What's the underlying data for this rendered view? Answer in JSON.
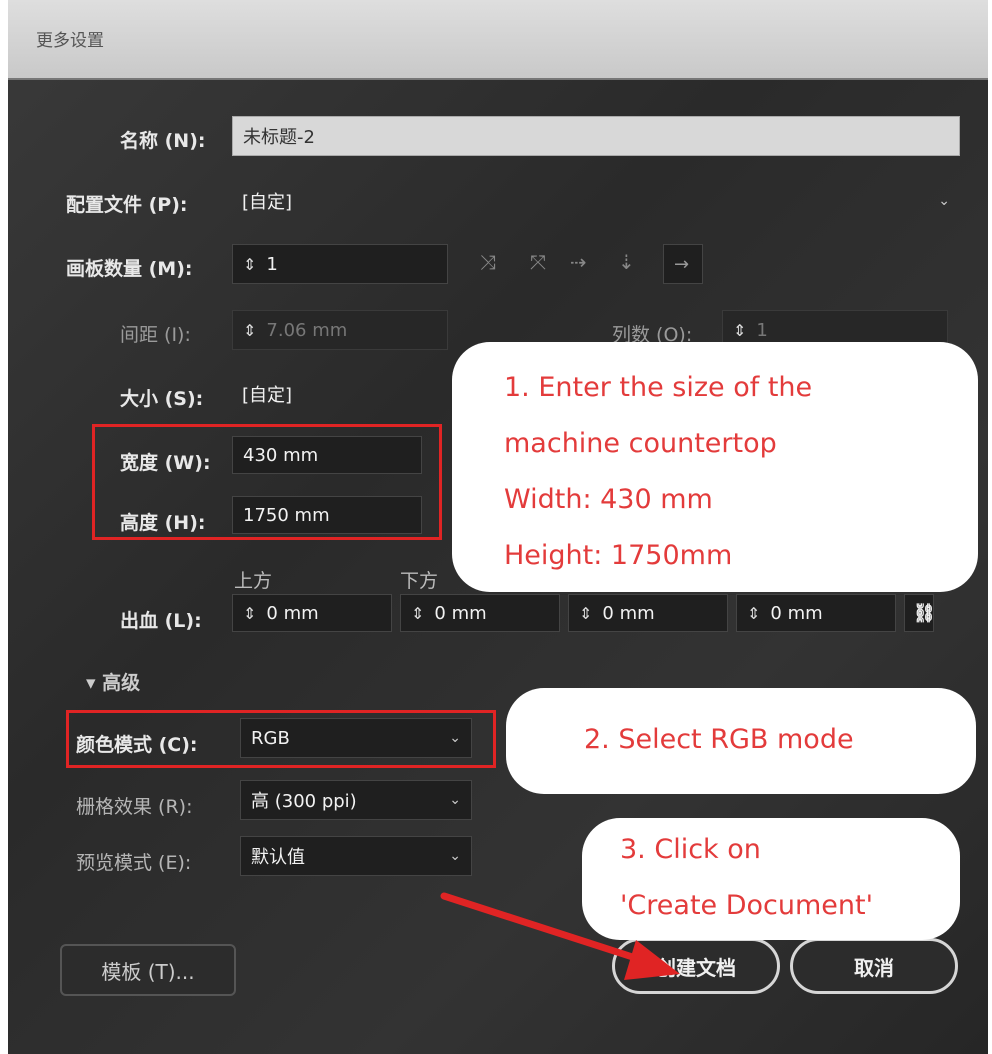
{
  "dialog": {
    "title": "更多设置",
    "fields": {
      "name": {
        "label": "名称 (N):",
        "value": "未标题-2"
      },
      "profile": {
        "label": "配置文件 (P):",
        "value": "[自定]"
      },
      "artboards": {
        "label": "画板数量 (M):",
        "value": "1"
      },
      "spacing": {
        "label": "间距 (I):",
        "value": "7.06 mm"
      },
      "columns": {
        "label": "列数 (O):",
        "value": "1"
      },
      "size": {
        "label": "大小 (S):",
        "value": "[自定]"
      },
      "width": {
        "label": "宽度 (W):",
        "value": "430 mm"
      },
      "height": {
        "label": "高度 (H):",
        "value": "1750 mm"
      },
      "bleed": {
        "label": "出血 (L):",
        "top_label": "上方",
        "bottom_label": "下方",
        "values": [
          "0 mm",
          "0 mm",
          "0 mm",
          "0 mm"
        ]
      },
      "advanced_label": "▾ 高级",
      "color_mode": {
        "label": "颜色模式 (C):",
        "value": "RGB"
      },
      "raster": {
        "label": "栅格效果 (R):",
        "value": "高 (300 ppi)"
      },
      "preview": {
        "label": "预览模式 (E):",
        "value": "默认值"
      }
    },
    "buttons": {
      "templates": "模板 (T)...",
      "create": "创建文档",
      "cancel": "取消"
    }
  },
  "annotations": {
    "step1": [
      "1. Enter the size of the",
      "machine countertop",
      "Width: 430 mm",
      "Height: 1750mm"
    ],
    "step2": "2. Select RGB mode",
    "step3": [
      "3. Click on",
      "'Create Document'"
    ]
  },
  "colors": {
    "annotation_red": "#e02424",
    "bubble_text": "#e33b3b",
    "dialog_bg": "#2f2f2f"
  }
}
